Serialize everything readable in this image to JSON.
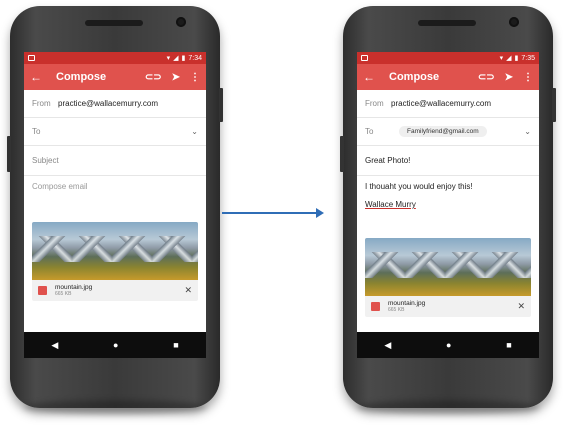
{
  "left_phone": {
    "status_time": "7:34",
    "toolbar_title": "Compose",
    "from_label": "From",
    "from_value": "practice@wallacemurry.com",
    "to_label": "To",
    "subject_placeholder": "Subject",
    "body_placeholder": "Compose email",
    "attachment_name": "mountain.jpg",
    "attachment_size": "665 KB"
  },
  "right_phone": {
    "status_time": "7:35",
    "toolbar_title": "Compose",
    "from_label": "From",
    "from_value": "practice@wallacemurry.com",
    "to_label": "To",
    "to_chip": "Familyfriend@gmail.com",
    "subject_value": "Great Photo!",
    "body_line1": "I thouaht you would enjoy this!",
    "body_line2": "Wallace Murry",
    "attachment_name": "mountain.jpg",
    "attachment_size": "665 KB"
  },
  "colors": {
    "toolbar": "#e0524d",
    "statusbar": "#c9302c",
    "arrow": "#2f6db6"
  },
  "icons": {
    "back": "arrow-left-icon",
    "attach": "paperclip-icon",
    "send": "send-icon",
    "more": "more-vert-icon",
    "nav_back": "triangle-back-icon",
    "nav_home": "circle-home-icon",
    "nav_recent": "square-recent-icon"
  }
}
